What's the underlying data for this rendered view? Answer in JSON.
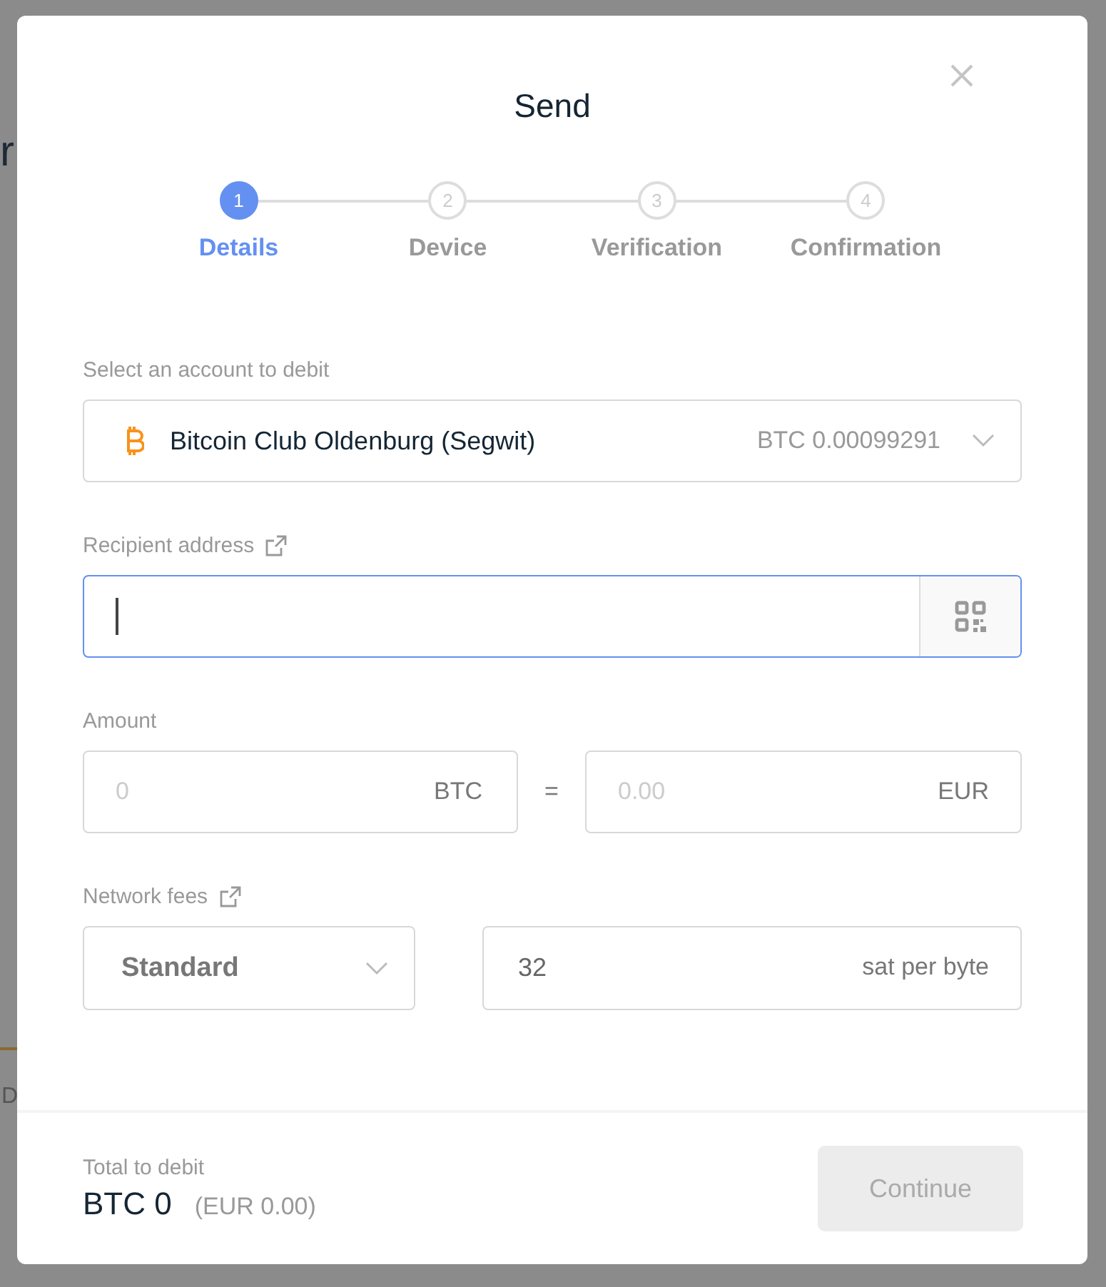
{
  "background": {
    "fragments": [
      {
        "text": "r",
        "kind": "heading"
      },
      {
        "text": "D",
        "kind": "tab"
      }
    ]
  },
  "modal": {
    "title": "Send",
    "steps": [
      {
        "number": "1",
        "label": "Details",
        "selected": true
      },
      {
        "number": "2",
        "label": "Device",
        "selected": false
      },
      {
        "number": "3",
        "label": "Verification",
        "selected": false
      },
      {
        "number": "4",
        "label": "Confirmation",
        "selected": false
      }
    ],
    "account": {
      "label": "Select an account to debit",
      "name": "Bitcoin Club Oldenburg (Segwit)",
      "balance": "BTC 0.00099291"
    },
    "recipient": {
      "label": "Recipient address",
      "focused": true
    },
    "amount": {
      "label": "Amount",
      "crypto": {
        "placeholder": "0",
        "unit": "BTC"
      },
      "equals": "=",
      "fiat": {
        "placeholder": "0.00",
        "unit": "EUR"
      }
    },
    "fees": {
      "label": "Network fees",
      "preset": "Standard",
      "value": "32",
      "unit": "sat per byte"
    },
    "footer": {
      "label": "Total to debit",
      "amount": "BTC 0",
      "fiat": "(EUR 0.00)",
      "button": {
        "label": "Continue",
        "disabled": true
      }
    }
  }
}
